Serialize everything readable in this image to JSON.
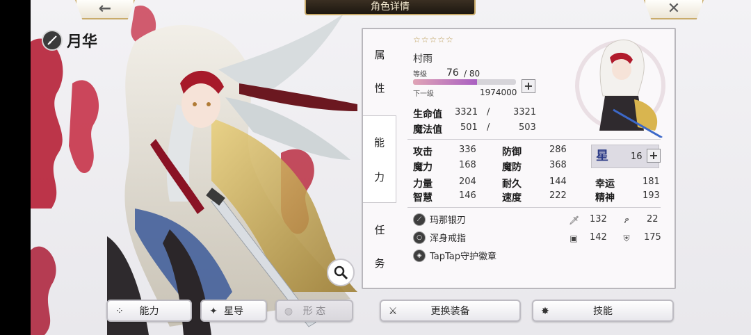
{
  "header": {
    "title": "角色详情",
    "back_icon": "←",
    "close_icon": "✕"
  },
  "character": {
    "name": "月华"
  },
  "tabs": [
    {
      "c1": "属",
      "c2": "性"
    },
    {
      "c1": "能",
      "c2": "力"
    },
    {
      "c1": "任",
      "c2": "务"
    }
  ],
  "profile": {
    "stars": "☆☆☆☆☆",
    "class_name": "村雨",
    "level_label": "等级",
    "level": "76",
    "level_max": "/ 80",
    "exp_fraction": 0.62,
    "next_label": "下一级",
    "next_exp": "1974000",
    "plus": "+"
  },
  "vitals": {
    "hp_label": "生命值",
    "hp_cur": "3321",
    "hp_max": "3321",
    "mp_label": "魔法值",
    "mp_cur": "501",
    "mp_max": "503",
    "slash": "/"
  },
  "stats": {
    "atk_label": "攻击",
    "atk": "336",
    "def_label": "防御",
    "def": "286",
    "mag_label": "魔力",
    "mag": "168",
    "mdef_label": "魔防",
    "mdef": "368",
    "str_label": "力量",
    "str": "204",
    "dur_label": "耐久",
    "dur": "144",
    "luck_label": "幸运",
    "luck": "181",
    "int_label": "智慧",
    "int": "146",
    "spd_label": "速度",
    "spd": "222",
    "spi_label": "精神",
    "spi": "193",
    "star_guide_value": "16"
  },
  "equipment": [
    {
      "name": "玛那银刃",
      "stat1": "132",
      "stat2": "22"
    },
    {
      "name": "浑身戒指",
      "stat1": "142",
      "stat2": "175"
    },
    {
      "name": "TapTap守护徽章"
    }
  ],
  "buttons": {
    "ability": "能力",
    "star_guide": "星导",
    "form": "形 态",
    "change_equip": "更换装备",
    "skill": "技能"
  },
  "colors": {
    "accent_gold": "#c8a968",
    "panel_bg": "#faf8fa",
    "exp_gradient_end": "#a95fc1"
  }
}
